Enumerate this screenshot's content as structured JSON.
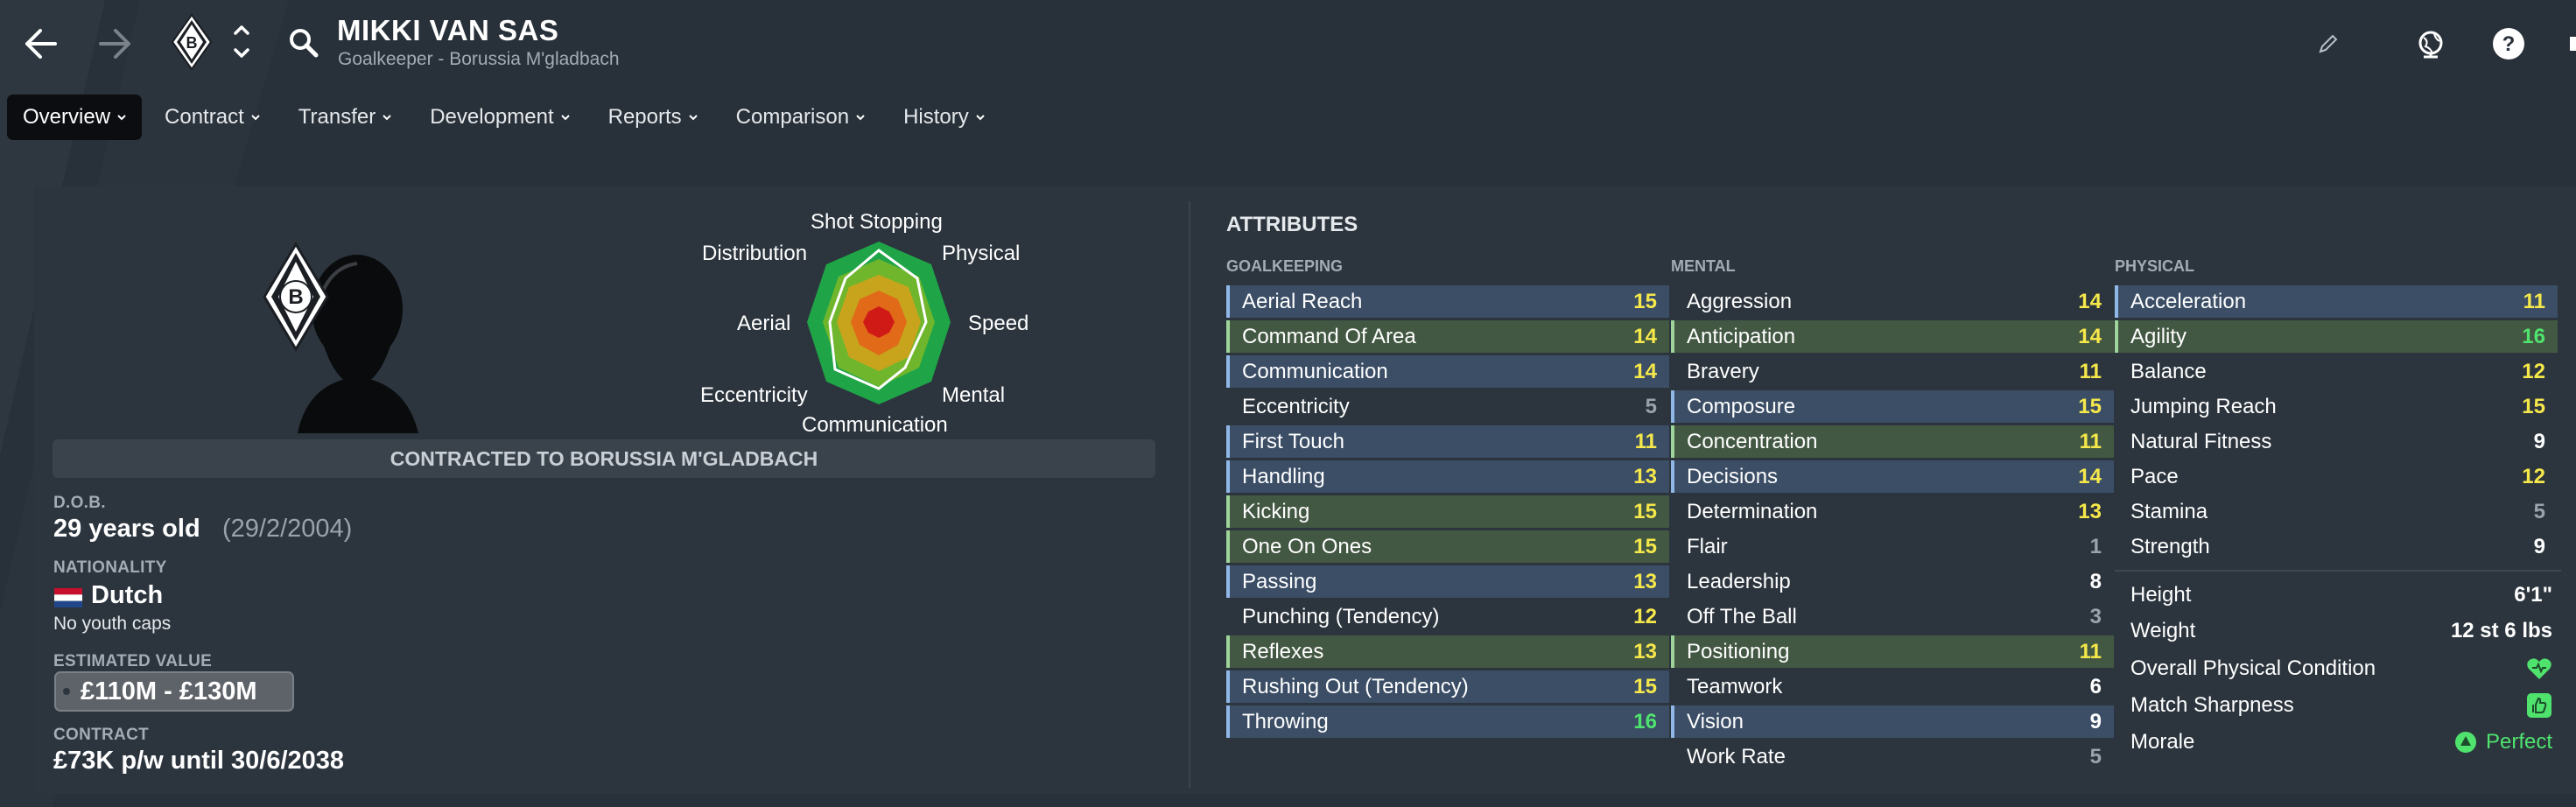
{
  "header": {
    "player_name": "MIKKI VAN SAS",
    "subtitle": "Goalkeeper - Borussia M'gladbach"
  },
  "tabs": [
    {
      "label": "Overview",
      "active": true
    },
    {
      "label": "Contract",
      "active": false
    },
    {
      "label": "Transfer",
      "active": false
    },
    {
      "label": "Development",
      "active": false
    },
    {
      "label": "Reports",
      "active": false
    },
    {
      "label": "Comparison",
      "active": false
    },
    {
      "label": "History",
      "active": false
    }
  ],
  "radar": {
    "labels": {
      "top": "Shot Stopping",
      "top_left": "Distribution",
      "top_right": "Physical",
      "left": "Aerial",
      "right": "Speed",
      "bottom_left": "Eccentricity",
      "bottom_right": "Mental",
      "bottom": "Communication"
    }
  },
  "profile": {
    "contract_banner": "CONTRACTED TO BORUSSIA M'GLADBACH",
    "dob_label": "D.O.B.",
    "age": "29 years old",
    "dob": "(29/2/2004)",
    "nationality_label": "NATIONALITY",
    "nationality": "Dutch",
    "youth_caps": "No youth caps",
    "value_label": "ESTIMATED VALUE",
    "value": "£110M - £130M",
    "contract_label": "CONTRACT",
    "contract": "£73K p/w until 30/6/2038"
  },
  "attributes": {
    "title": "ATTRIBUTES",
    "goalkeeping": {
      "title": "GOALKEEPING",
      "rows": [
        {
          "name": "Aerial Reach",
          "value": "15",
          "hl": "blue",
          "color": "yellow"
        },
        {
          "name": "Command Of Area",
          "value": "14",
          "hl": "green",
          "color": "yellow"
        },
        {
          "name": "Communication",
          "value": "14",
          "hl": "blue",
          "color": "yellow"
        },
        {
          "name": "Eccentricity",
          "value": "5",
          "hl": "plain",
          "color": "grey"
        },
        {
          "name": "First Touch",
          "value": "11",
          "hl": "blue",
          "color": "yellow"
        },
        {
          "name": "Handling",
          "value": "13",
          "hl": "blue",
          "color": "yellow"
        },
        {
          "name": "Kicking",
          "value": "15",
          "hl": "green",
          "color": "yellow"
        },
        {
          "name": "One On Ones",
          "value": "15",
          "hl": "green",
          "color": "yellow"
        },
        {
          "name": "Passing",
          "value": "13",
          "hl": "blue",
          "color": "yellow"
        },
        {
          "name": "Punching (Tendency)",
          "value": "12",
          "hl": "plain",
          "color": "yellow"
        },
        {
          "name": "Reflexes",
          "value": "13",
          "hl": "green",
          "color": "yellow"
        },
        {
          "name": "Rushing Out (Tendency)",
          "value": "15",
          "hl": "blue",
          "color": "yellow"
        },
        {
          "name": "Throwing",
          "value": "16",
          "hl": "blue",
          "color": "green"
        }
      ]
    },
    "mental": {
      "title": "MENTAL",
      "rows": [
        {
          "name": "Aggression",
          "value": "14",
          "hl": "plain",
          "color": "yellow"
        },
        {
          "name": "Anticipation",
          "value": "14",
          "hl": "green",
          "color": "yellow"
        },
        {
          "name": "Bravery",
          "value": "11",
          "hl": "plain",
          "color": "yellow"
        },
        {
          "name": "Composure",
          "value": "15",
          "hl": "blue",
          "color": "yellow"
        },
        {
          "name": "Concentration",
          "value": "11",
          "hl": "green",
          "color": "yellow"
        },
        {
          "name": "Decisions",
          "value": "14",
          "hl": "blue",
          "color": "yellow"
        },
        {
          "name": "Determination",
          "value": "13",
          "hl": "plain",
          "color": "yellow"
        },
        {
          "name": "Flair",
          "value": "1",
          "hl": "plain",
          "color": "grey"
        },
        {
          "name": "Leadership",
          "value": "8",
          "hl": "plain",
          "color": "white"
        },
        {
          "name": "Off The Ball",
          "value": "3",
          "hl": "plain",
          "color": "grey"
        },
        {
          "name": "Positioning",
          "value": "11",
          "hl": "green",
          "color": "yellow"
        },
        {
          "name": "Teamwork",
          "value": "6",
          "hl": "plain",
          "color": "white"
        },
        {
          "name": "Vision",
          "value": "9",
          "hl": "blue",
          "color": "white"
        },
        {
          "name": "Work Rate",
          "value": "5",
          "hl": "plain",
          "color": "grey"
        }
      ]
    },
    "physical": {
      "title": "PHYSICAL",
      "rows": [
        {
          "name": "Acceleration",
          "value": "11",
          "hl": "blue",
          "color": "yellow"
        },
        {
          "name": "Agility",
          "value": "16",
          "hl": "green",
          "color": "green"
        },
        {
          "name": "Balance",
          "value": "12",
          "hl": "plain",
          "color": "yellow"
        },
        {
          "name": "Jumping Reach",
          "value": "15",
          "hl": "plain",
          "color": "yellow"
        },
        {
          "name": "Natural Fitness",
          "value": "9",
          "hl": "plain",
          "color": "white"
        },
        {
          "name": "Pace",
          "value": "12",
          "hl": "plain",
          "color": "yellow"
        },
        {
          "name": "Stamina",
          "value": "5",
          "hl": "plain",
          "color": "grey"
        },
        {
          "name": "Strength",
          "value": "9",
          "hl": "plain",
          "color": "white"
        }
      ]
    },
    "info": {
      "height_label": "Height",
      "height": "6'1\"",
      "weight_label": "Weight",
      "weight": "12 st 6 lbs",
      "condition_label": "Overall Physical Condition",
      "sharpness_label": "Match Sharpness",
      "morale_label": "Morale",
      "morale": "Perfect"
    }
  },
  "colors": {
    "yellow": "#f6e84a",
    "green": "#4fe36e",
    "grey": "#9aa2ab",
    "white": "#ffffff"
  }
}
